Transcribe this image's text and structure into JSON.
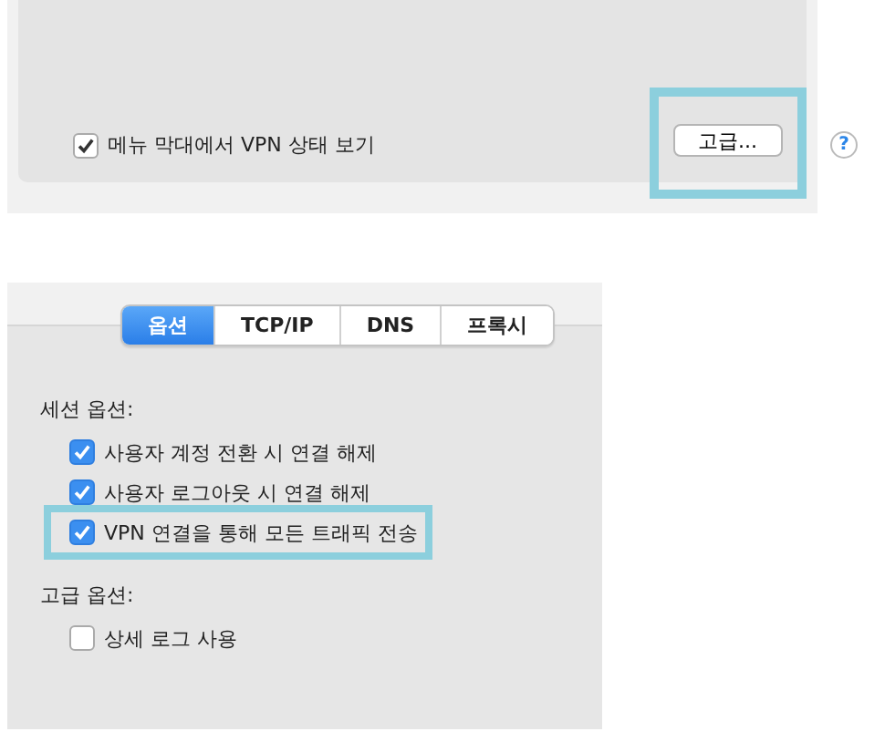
{
  "menu_bar_option": {
    "label": "메뉴 막대에서 VPN 상태 보기",
    "checked": true
  },
  "advanced_button": {
    "label": "고급...",
    "highlighted": true
  },
  "help_button": {
    "label": "?"
  },
  "tabs": [
    {
      "label": "옵션",
      "selected": true
    },
    {
      "label": "TCP/IP",
      "selected": false
    },
    {
      "label": "DNS",
      "selected": false
    },
    {
      "label": "프록시",
      "selected": false
    }
  ],
  "sections": [
    {
      "title": "세션 옵션:",
      "options": [
        {
          "label": "사용자 계정 전환 시 연결 해제",
          "checked": true,
          "highlighted": false
        },
        {
          "label": "사용자 로그아웃 시 연결 해제",
          "checked": true,
          "highlighted": false
        },
        {
          "label": "VPN 연결을 통해 모든 트래픽 전송",
          "checked": true,
          "highlighted": true
        }
      ]
    },
    {
      "title": "고급 옵션:",
      "options": [
        {
          "label": "상세 로그 사용",
          "checked": false,
          "highlighted": false
        }
      ]
    }
  ]
}
